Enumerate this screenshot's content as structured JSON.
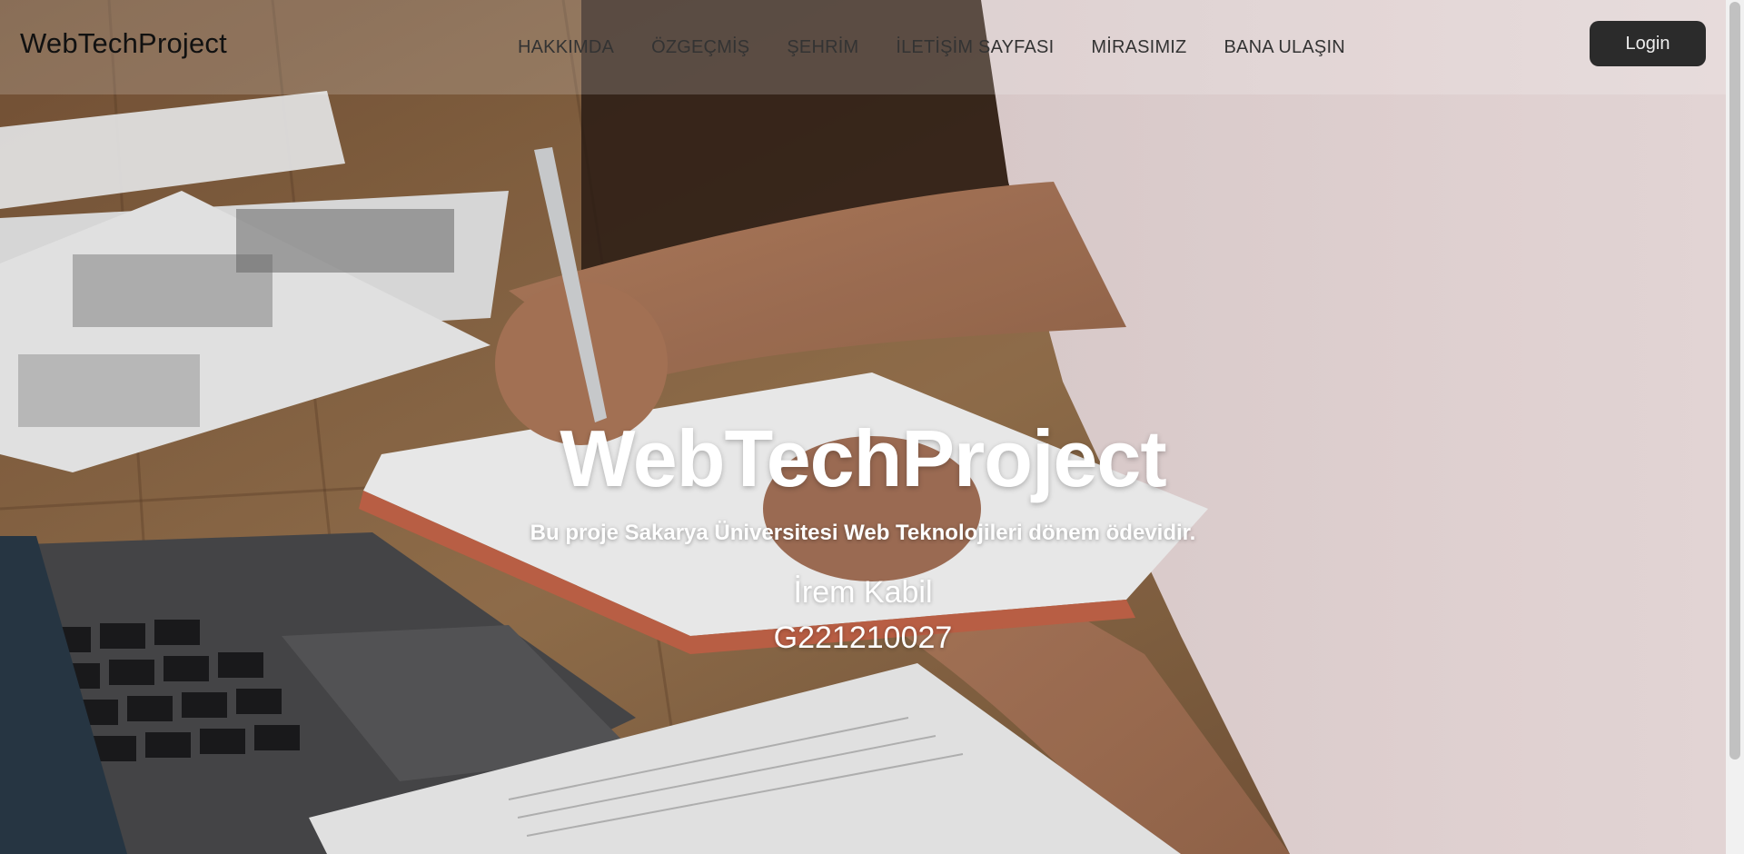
{
  "navbar": {
    "brand": "WebTechProject",
    "links": [
      "HAKKIMDA",
      "ÖZGEÇMİŞ",
      "ŞEHRİM",
      "İLETİŞİM SAYFASI",
      "MİRASIMIZ",
      "BANA ULAŞIN"
    ],
    "login_label": "Login"
  },
  "hero": {
    "title": "WebTechProject",
    "subtitle": "Bu proje Sakarya Üniversitesi Web Teknolojileri dönem ödevidir.",
    "name": "İrem Kabil",
    "student_id": "G221210027"
  },
  "colors": {
    "login_bg": "#2b2b2b",
    "hero_text": "#ffffff",
    "navbar_text": "#333333"
  }
}
